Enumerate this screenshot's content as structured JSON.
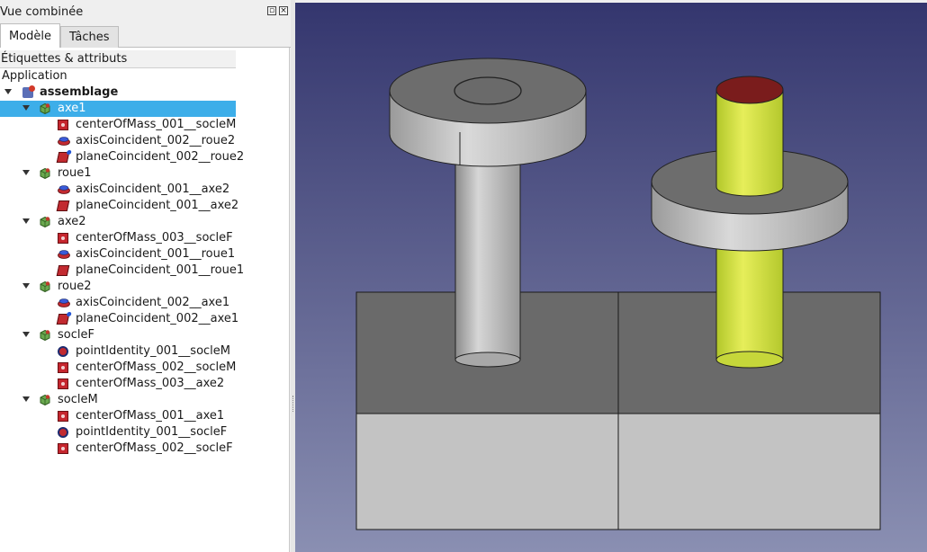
{
  "panel": {
    "title": "Vue combinée",
    "tabs": {
      "model": "Modèle",
      "tasks": "Tâches"
    },
    "tree_header": "Étiquettes & attributs",
    "application_label": "Application"
  },
  "tree": {
    "root": {
      "label": "assemblage",
      "icon": "assembly-icon"
    },
    "nodes": [
      {
        "label": "axe1",
        "icon": "part-icon",
        "selected": true,
        "children": [
          {
            "label": "centerOfMass_001__socleM",
            "icon": "center-of-mass-icon"
          },
          {
            "label": "axisCoincident_002__roue2",
            "icon": "axis-coincident-icon"
          },
          {
            "label": "planeCoincident_002__roue2",
            "icon": "plane-coincident-icon"
          }
        ]
      },
      {
        "label": "roue1",
        "icon": "part-icon",
        "selected": false,
        "children": [
          {
            "label": "axisCoincident_001__axe2",
            "icon": "axis-coincident-icon"
          },
          {
            "label": "planeCoincident_001__axe2",
            "icon": "plane-coincident-icon"
          }
        ]
      },
      {
        "label": "axe2",
        "icon": "part-icon",
        "selected": false,
        "children": [
          {
            "label": "centerOfMass_003__socleF",
            "icon": "center-of-mass-icon"
          },
          {
            "label": "axisCoincident_001__roue1",
            "icon": "axis-coincident-icon"
          },
          {
            "label": "planeCoincident_001__roue1",
            "icon": "plane-coincident-icon"
          }
        ]
      },
      {
        "label": "roue2",
        "icon": "part-icon",
        "selected": false,
        "children": [
          {
            "label": "axisCoincident_002__axe1",
            "icon": "axis-coincident-icon"
          },
          {
            "label": "planeCoincident_002__axe1",
            "icon": "plane-coincident-icon"
          }
        ]
      },
      {
        "label": "socleF",
        "icon": "part-icon",
        "selected": false,
        "children": [
          {
            "label": "pointIdentity_001__socleM",
            "icon": "point-identity-icon"
          },
          {
            "label": "centerOfMass_002__socleM",
            "icon": "center-of-mass-icon"
          },
          {
            "label": "centerOfMass_003__axe2",
            "icon": "center-of-mass-icon"
          }
        ]
      },
      {
        "label": "socleM",
        "icon": "part-icon",
        "selected": false,
        "children": [
          {
            "label": "centerOfMass_001__axe1",
            "icon": "center-of-mass-icon"
          },
          {
            "label": "pointIdentity_001__socleF",
            "icon": "point-identity-icon"
          },
          {
            "label": "centerOfMass_002__socleF",
            "icon": "center-of-mass-icon"
          }
        ]
      }
    ]
  },
  "colors": {
    "selection": "#3daee9",
    "view_top": "#34366e",
    "view_bottom": "#8a8fb2",
    "shaft_yellow": "#cfe13c",
    "shaft_top": "#7a1c1c"
  }
}
